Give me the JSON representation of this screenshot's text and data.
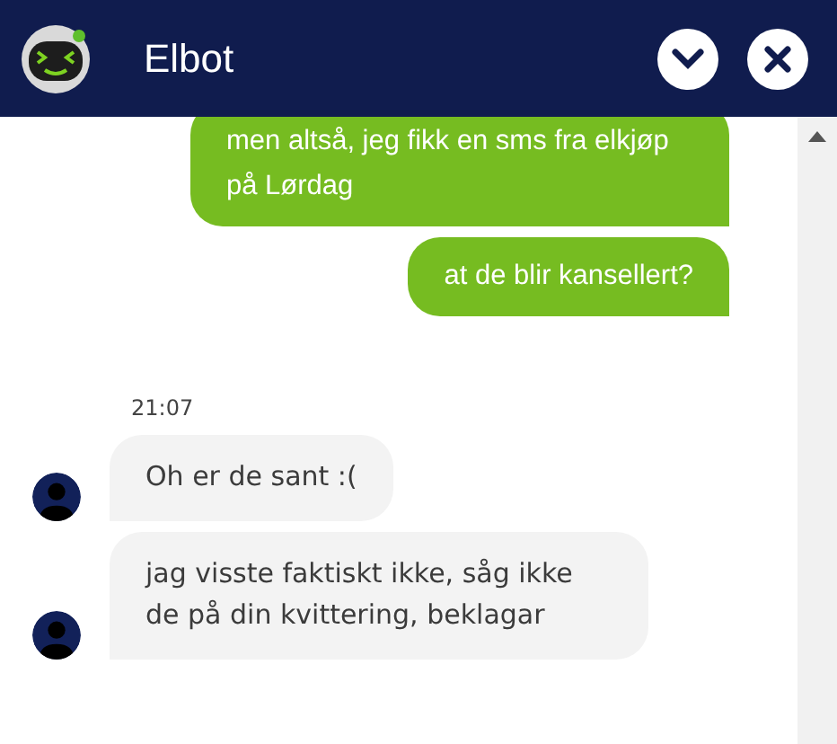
{
  "header": {
    "title": "Elbot"
  },
  "messages": [
    {
      "kind": "user",
      "text": "men altså, jeg fikk en sms fra elkjøp på Lørdag"
    },
    {
      "kind": "user",
      "text": "at de blir kansellert?"
    },
    {
      "kind": "time",
      "text": "21:07"
    },
    {
      "kind": "bot",
      "text": "Oh er de sant :("
    },
    {
      "kind": "bot",
      "text": "jag visste faktiskt ikke, såg ikke de på din kvittering, beklagar"
    }
  ]
}
